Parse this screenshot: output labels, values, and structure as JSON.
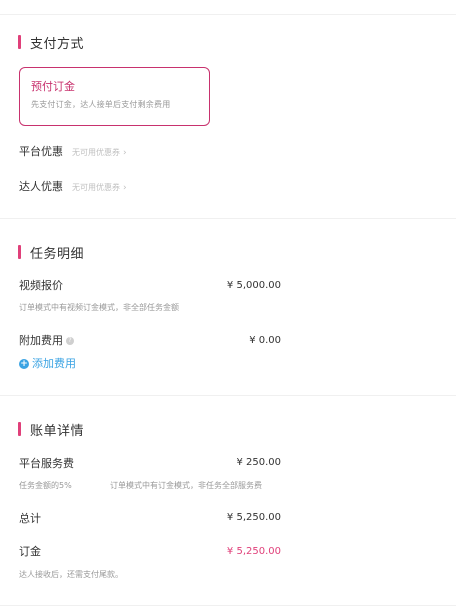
{
  "payment": {
    "title": "支付方式",
    "method_name": "预付订金",
    "method_desc": "先支付订金，达人接单后支付剩余费用",
    "platform_coupon_label": "平台优惠",
    "platform_coupon_value": "无可用优惠券",
    "talent_coupon_label": "达人优惠",
    "talent_coupon_value": "无可用优惠券"
  },
  "task": {
    "title": "任务明细",
    "video_price_label": "视频报价",
    "video_price_value": "¥ 5,000.00",
    "video_price_note": "订单模式中有视频订金模式，非全部任务金额",
    "extra_fee_label": "附加费用",
    "extra_fee_value": "¥ 0.00",
    "add_fee_label": "添加费用"
  },
  "bill": {
    "title": "账单详情",
    "service_fee_label": "平台服务费",
    "service_fee_value": "¥ 250.00",
    "service_fee_rate": "任务金额的5%",
    "service_fee_note": "订单模式中有订金模式，非任务全部服务费",
    "total_label": "总计",
    "total_value": "¥ 5,250.00",
    "deposit_label": "订金",
    "deposit_value": "¥ 5,250.00",
    "deposit_note": "达人接收后，还需支付尾款。"
  },
  "colors": {
    "accent": "#e0407a",
    "link": "#3aa3e3"
  }
}
